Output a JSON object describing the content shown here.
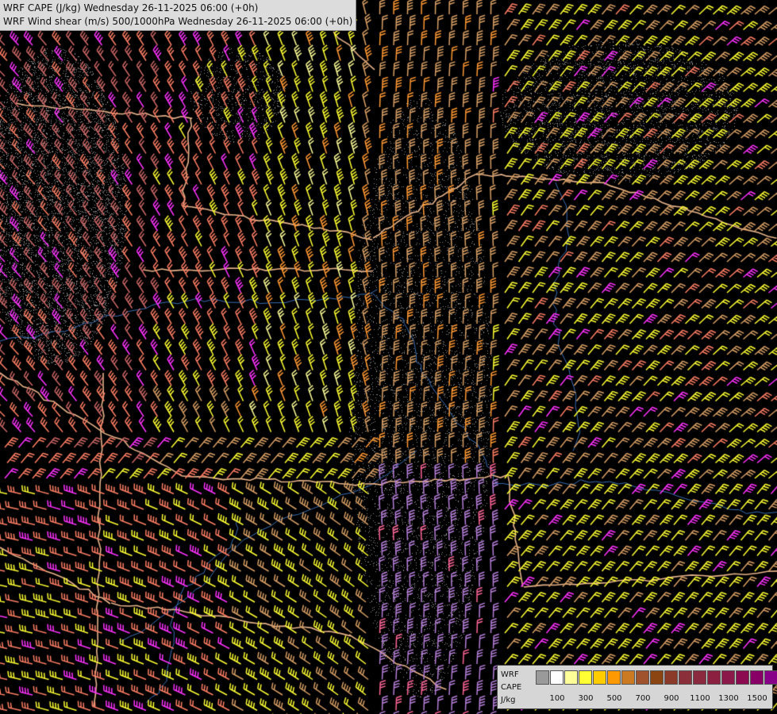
{
  "titles": {
    "line1": "WRF CAPE (J/kg) Wednesday 26-11-2025 06:00 (+0h)",
    "line2": "WRF Wind shear (m/s) 500/1000hPa Wednesday 26-11-2025 06:00 (+0h)"
  },
  "legend": {
    "model_label": "WRF",
    "variable_label": "CAPE",
    "unit_label": "J/kg",
    "colors": [
      "#9a9a9a",
      "#ffffff",
      "#ffff99",
      "#ffff33",
      "#ffcc00",
      "#ff9900",
      "#cc7a22",
      "#a0522d",
      "#8b4513",
      "#8b3a2a",
      "#8b2f3a",
      "#8b2a3f",
      "#8b2040",
      "#8b1a4a",
      "#8b0a50",
      "#880066",
      "#880088"
    ],
    "tick_labels": [
      "100",
      "300",
      "500",
      "700",
      "900",
      "1100",
      "1300",
      "1500"
    ]
  },
  "barb_palette": {
    "magenta": "#ff33ff",
    "pink": "#ff6699",
    "salmon": "#ff7f66",
    "rose": "#cc6666",
    "tan": "#d9a066",
    "orange": "#ff9933",
    "yellow": "#ffff33",
    "pale_yellow": "#ffff99",
    "lavender": "#b67fd9"
  },
  "map_colors": {
    "background": "#000000",
    "border_line": "#e8b48c",
    "river_line": "#3a6fb5",
    "stipple": "#8c8c8c"
  }
}
